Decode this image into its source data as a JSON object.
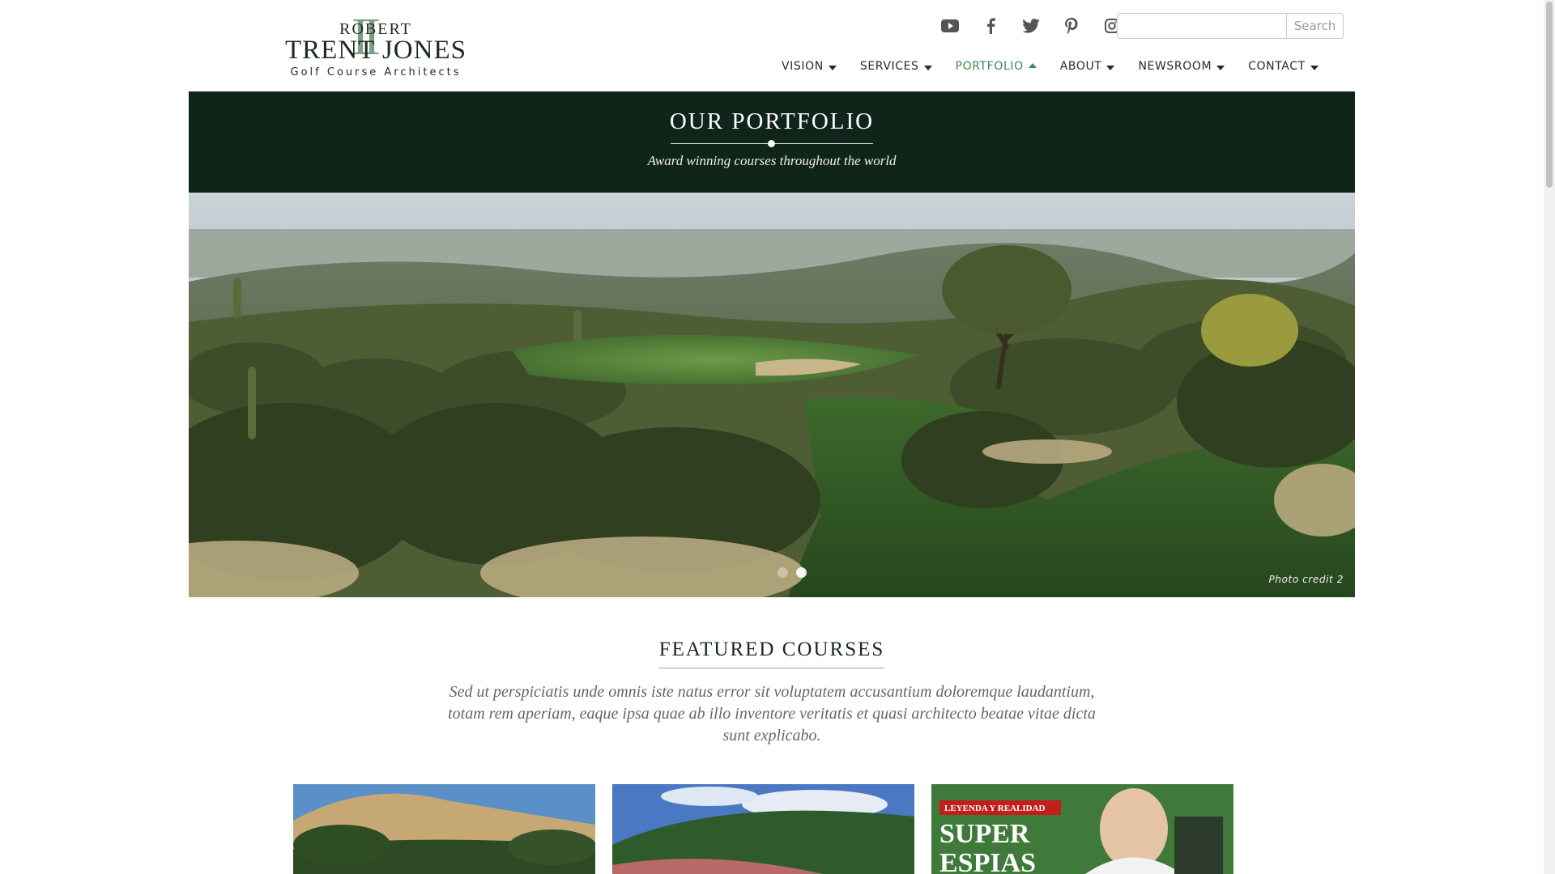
{
  "logo": {
    "roman": "II",
    "robert": "ROBERT",
    "name": "TRENT JONES",
    "tagline": "Golf Course Architects"
  },
  "social": [
    {
      "icon": "youtube-icon"
    },
    {
      "icon": "facebook-icon"
    },
    {
      "icon": "twitter-icon"
    },
    {
      "icon": "pinterest-icon"
    },
    {
      "icon": "instagram-icon"
    }
  ],
  "search": {
    "value": "",
    "placeholder": "",
    "button": "Search"
  },
  "nav": [
    {
      "label": "VISION",
      "active": false
    },
    {
      "label": "SERVICES",
      "active": false
    },
    {
      "label": "PORTFOLIO",
      "active": true
    },
    {
      "label": "ABOUT",
      "active": false
    },
    {
      "label": "NEWSROOM",
      "active": false
    },
    {
      "label": "CONTACT",
      "active": false
    }
  ],
  "banner": {
    "title": "OUR PORTFOLIO",
    "tagline": "Award winning courses throughout the world"
  },
  "hero": {
    "credit": "Photo credit 2",
    "slides": 2,
    "active_slide": 2
  },
  "featured": {
    "title": "FEATURED COURSES",
    "description": "Sed ut perspiciatis unde omnis iste natus error sit voluptatem accusantium doloremque laudantium, totam rem aperiam, eaque ipsa quae ab illo inventore veritatis et quasi architecto beatae vitae dicta sunt explicabo."
  },
  "cards": [
    {
      "alt": "card-1"
    },
    {
      "alt": "card-2"
    },
    {
      "alt": "card-3",
      "banner_text": "LEYENDA Y REALIDAD",
      "headline_1": "SUPER",
      "headline_2": "ESPIAS"
    }
  ],
  "colors": {
    "banner_bg": "#0f2519",
    "nav_active": "#3a8a52",
    "accent_green": "#7f9e86"
  }
}
